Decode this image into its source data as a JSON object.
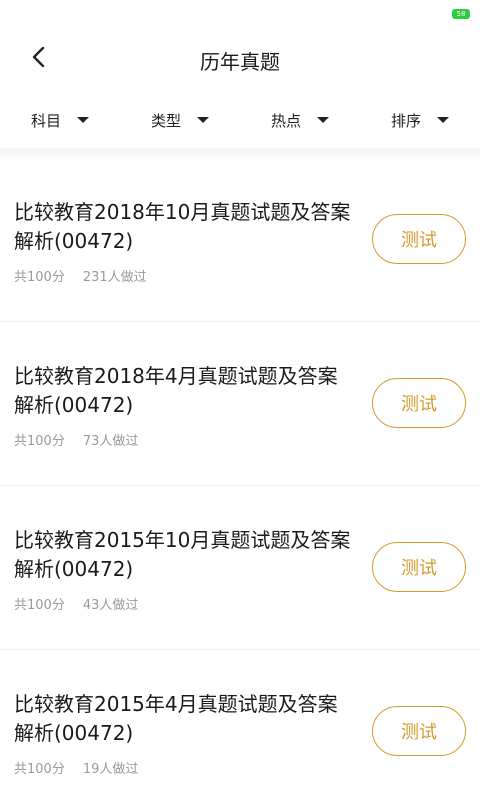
{
  "status_bar": {
    "battery": "58"
  },
  "header": {
    "title": "历年真题"
  },
  "filters": [
    {
      "label": "科目"
    },
    {
      "label": "类型"
    },
    {
      "label": "热点"
    },
    {
      "label": "排序"
    }
  ],
  "items": [
    {
      "title": "比较教育2018年10月真题试题及答案解析(00472)",
      "score": "共100分",
      "count": "231人做过",
      "button": "测试"
    },
    {
      "title": "比较教育2018年4月真题试题及答案解析(00472)",
      "score": "共100分",
      "count": "73人做过",
      "button": "测试"
    },
    {
      "title": "比较教育2015年10月真题试题及答案解析(00472)",
      "score": "共100分",
      "count": "43人做过",
      "button": "测试"
    },
    {
      "title": "比较教育2015年4月真题试题及答案解析(00472)",
      "score": "共100分",
      "count": "19人做过",
      "button": "测试"
    }
  ],
  "colors": {
    "accent": "#d49a2e",
    "battery": "#2ecc40"
  },
  "icons": {
    "back": "chevron-left-icon",
    "dropdown": "caret-down-icon"
  }
}
